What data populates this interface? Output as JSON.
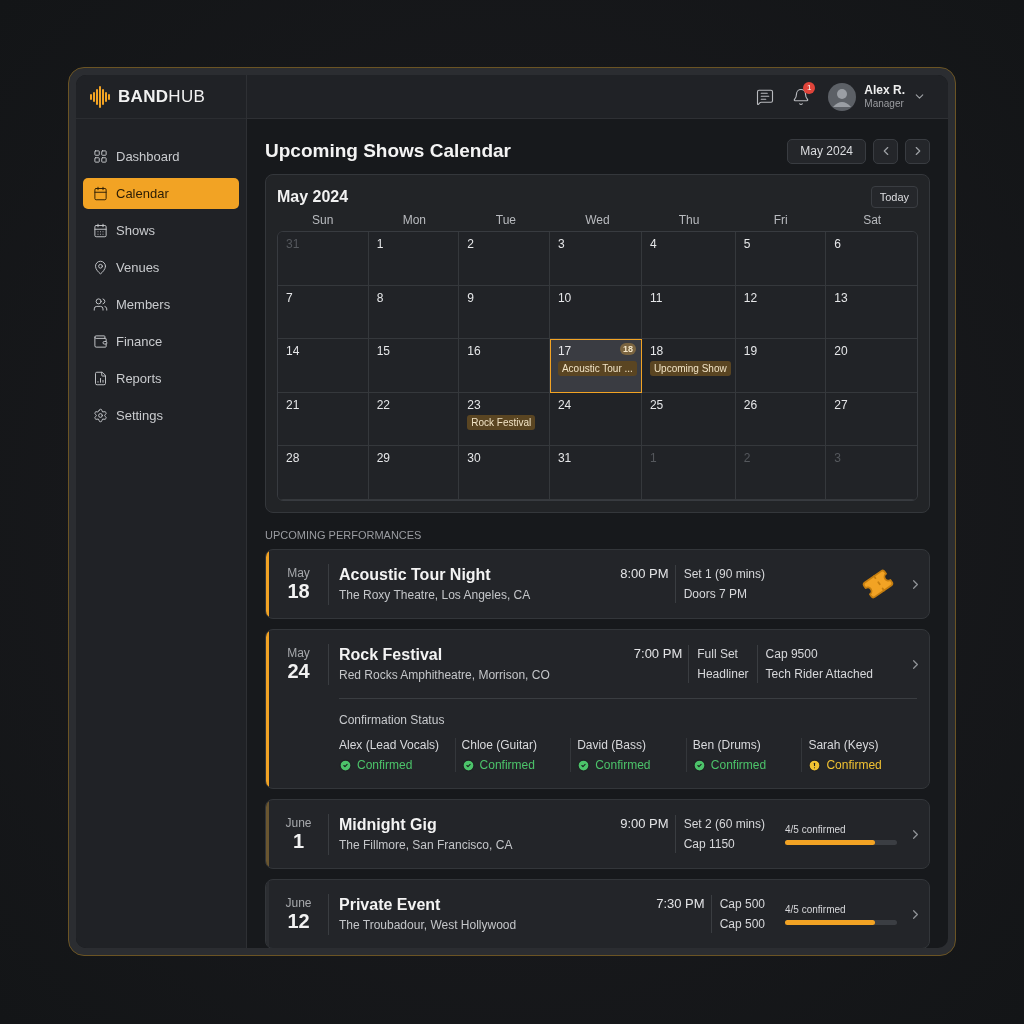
{
  "brand": {
    "strong": "BAND",
    "light": "HUB"
  },
  "sidebar": {
    "items": [
      {
        "label": "Dashboard",
        "selected": false
      },
      {
        "label": "Calendar",
        "selected": true
      },
      {
        "label": "Shows",
        "selected": false
      },
      {
        "label": "Venues",
        "selected": false
      },
      {
        "label": "Members",
        "selected": false
      },
      {
        "label": "Finance",
        "selected": false
      },
      {
        "label": "Reports",
        "selected": false
      },
      {
        "label": "Settings",
        "selected": false
      }
    ]
  },
  "topbar": {
    "notification_count": "1",
    "user": {
      "name": "Alex R.",
      "role": "Manager"
    }
  },
  "page_title": "Upcoming Shows Calendar",
  "month_picker": "May 2024",
  "calendar": {
    "title": "May 2024",
    "today_button": "Today",
    "weekdays": [
      "Sun",
      "Mon",
      "Tue",
      "Wed",
      "Thu",
      "Fri",
      "Sat"
    ],
    "weeks": [
      [
        {
          "day": "31",
          "muted": true,
          "selected": false
        },
        {
          "day": "1",
          "muted": false,
          "selected": false
        },
        {
          "day": "2",
          "muted": false,
          "selected": false
        },
        {
          "day": "3",
          "muted": false,
          "selected": false
        },
        {
          "day": "4",
          "muted": false,
          "selected": false
        },
        {
          "day": "5",
          "muted": false,
          "selected": false
        },
        {
          "day": "6",
          "muted": false,
          "selected": false
        }
      ],
      [
        {
          "day": "7",
          "muted": false,
          "selected": false
        },
        {
          "day": "8",
          "muted": false,
          "selected": false
        },
        {
          "day": "9",
          "muted": false,
          "selected": false
        },
        {
          "day": "10",
          "muted": false,
          "selected": false
        },
        {
          "day": "11",
          "muted": false,
          "selected": false
        },
        {
          "day": "12",
          "muted": false,
          "selected": false
        },
        {
          "day": "13",
          "muted": false,
          "selected": false
        }
      ],
      [
        {
          "day": "14",
          "muted": false,
          "selected": false
        },
        {
          "day": "15",
          "muted": false,
          "selected": false
        },
        {
          "day": "16",
          "muted": false,
          "selected": false
        },
        {
          "day": "17",
          "muted": false,
          "selected": true,
          "badge": "18",
          "events": [
            "Acoustic Tour ..."
          ]
        },
        {
          "day": "18",
          "muted": false,
          "selected": false,
          "events": [
            "Upcoming Show"
          ]
        },
        {
          "day": "19",
          "muted": false,
          "selected": false
        },
        {
          "day": "20",
          "muted": false,
          "selected": false
        }
      ],
      [
        {
          "day": "21",
          "muted": false,
          "selected": false
        },
        {
          "day": "22",
          "muted": false,
          "selected": false
        },
        {
          "day": "23",
          "muted": false,
          "selected": false,
          "events": [
            "Rock Festival"
          ]
        },
        {
          "day": "24",
          "muted": false,
          "selected": false
        },
        {
          "day": "25",
          "muted": false,
          "selected": false
        },
        {
          "day": "26",
          "muted": false,
          "selected": false
        },
        {
          "day": "27",
          "muted": false,
          "selected": false
        }
      ],
      [
        {
          "day": "28",
          "muted": false,
          "selected": false
        },
        {
          "day": "29",
          "muted": false,
          "selected": false
        },
        {
          "day": "30",
          "muted": false,
          "selected": false
        },
        {
          "day": "31",
          "muted": false,
          "selected": false
        },
        {
          "day": "1",
          "muted": true,
          "selected": false
        },
        {
          "day": "2",
          "muted": true,
          "selected": false
        },
        {
          "day": "3",
          "muted": true,
          "selected": false
        }
      ]
    ]
  },
  "section_label": "UPCOMING PERFORMANCES",
  "performances": [
    {
      "month": "May",
      "day": "18",
      "title": "Acoustic Tour Night",
      "venue": "The Roxy Theatre, Los Angeles, CA",
      "time": "8:00 PM",
      "highlighted": true,
      "dim_accent": false,
      "details": [
        [
          "Set 1 (90 mins)",
          "Doors 7 PM"
        ]
      ],
      "extra": {
        "kind": "ticket"
      }
    },
    {
      "month": "May",
      "day": "24",
      "title": "Rock Festival",
      "venue": "Red Rocks Amphitheatre, Morrison, CO",
      "time": "7:00 PM",
      "highlighted": true,
      "dim_accent": false,
      "details": [
        [
          "Full Set",
          "Headliner"
        ],
        [
          "Cap 9500",
          "Tech Rider Attached"
        ]
      ],
      "confirmation": {
        "title": "Confirmation Status",
        "members": [
          {
            "name": "Alex (Lead Vocals)",
            "warning": false,
            "label": "Confirmed"
          },
          {
            "name": "Chloe (Guitar)",
            "warning": false,
            "label": "Confirmed"
          },
          {
            "name": "David (Bass)",
            "warning": false,
            "label": "Confirmed"
          },
          {
            "name": "Ben (Drums)",
            "warning": false,
            "label": "Confirmed"
          },
          {
            "name": "Sarah (Keys)",
            "warning": true,
            "label": "Confirmed"
          }
        ]
      }
    },
    {
      "month": "June",
      "day": "1",
      "title": "Midnight Gig",
      "venue": "The Fillmore, San Francisco, CA",
      "time": "9:00 PM",
      "highlighted": false,
      "dim_accent": true,
      "details": [
        [
          "Set 2 (60 mins)",
          "Cap 1150"
        ]
      ],
      "extra": {
        "kind": "progress",
        "label": "4/5 confirmed",
        "level": 0.8
      }
    },
    {
      "month": "June",
      "day": "12",
      "title": "Private Event",
      "venue": "The Troubadour, West Hollywood",
      "time": "7:30 PM",
      "highlighted": false,
      "dim_accent": false,
      "details": [
        [
          "Cap 500",
          "Cap 500"
        ]
      ],
      "extra": {
        "kind": "progress",
        "label": "4/5 confirmed",
        "level": 0.8
      }
    }
  ]
}
